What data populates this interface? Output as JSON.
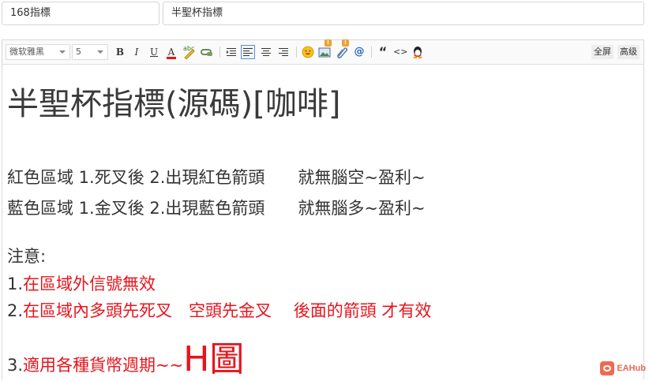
{
  "form": {
    "category_value": "168指標",
    "title_value": "半聖杯指標"
  },
  "toolbar": {
    "font_family": "微软雅黑",
    "font_size": "5",
    "bold": "B",
    "italic": "I",
    "underline": "U",
    "font_color": "A",
    "spellcheck": "abc",
    "quote": "“",
    "code": "<>",
    "fullscreen": "全屏",
    "advanced": "高级"
  },
  "content": {
    "heading": "半聖杯指標(源碼)[咖啡]",
    "line1": "紅色區域 1.死叉後 2.出現紅色箭頭　　就無腦空~盈利~",
    "line2": "藍色區域 1.金叉後 2.出現藍色箭頭　　就無腦多~盈利~",
    "note_label": "注意:",
    "item1_num": "1.",
    "item1_text": "在區域外信號無效",
    "item2_num": "2.",
    "item2_text": "在區域內多頭先死叉　空頭先金叉　 後面的箭頭 才有效",
    "item3_num": "3.",
    "item3_text": "適用各種貨幣週期~~",
    "item3_big": "H圖"
  },
  "watermark": {
    "text": "EAHub"
  },
  "colors": {
    "accent_red": "#e8141c",
    "watermark": "#f06a52"
  },
  "icons": [
    "smiley-icon",
    "image-icon",
    "attachment-icon",
    "at-icon",
    "qq-icon"
  ]
}
